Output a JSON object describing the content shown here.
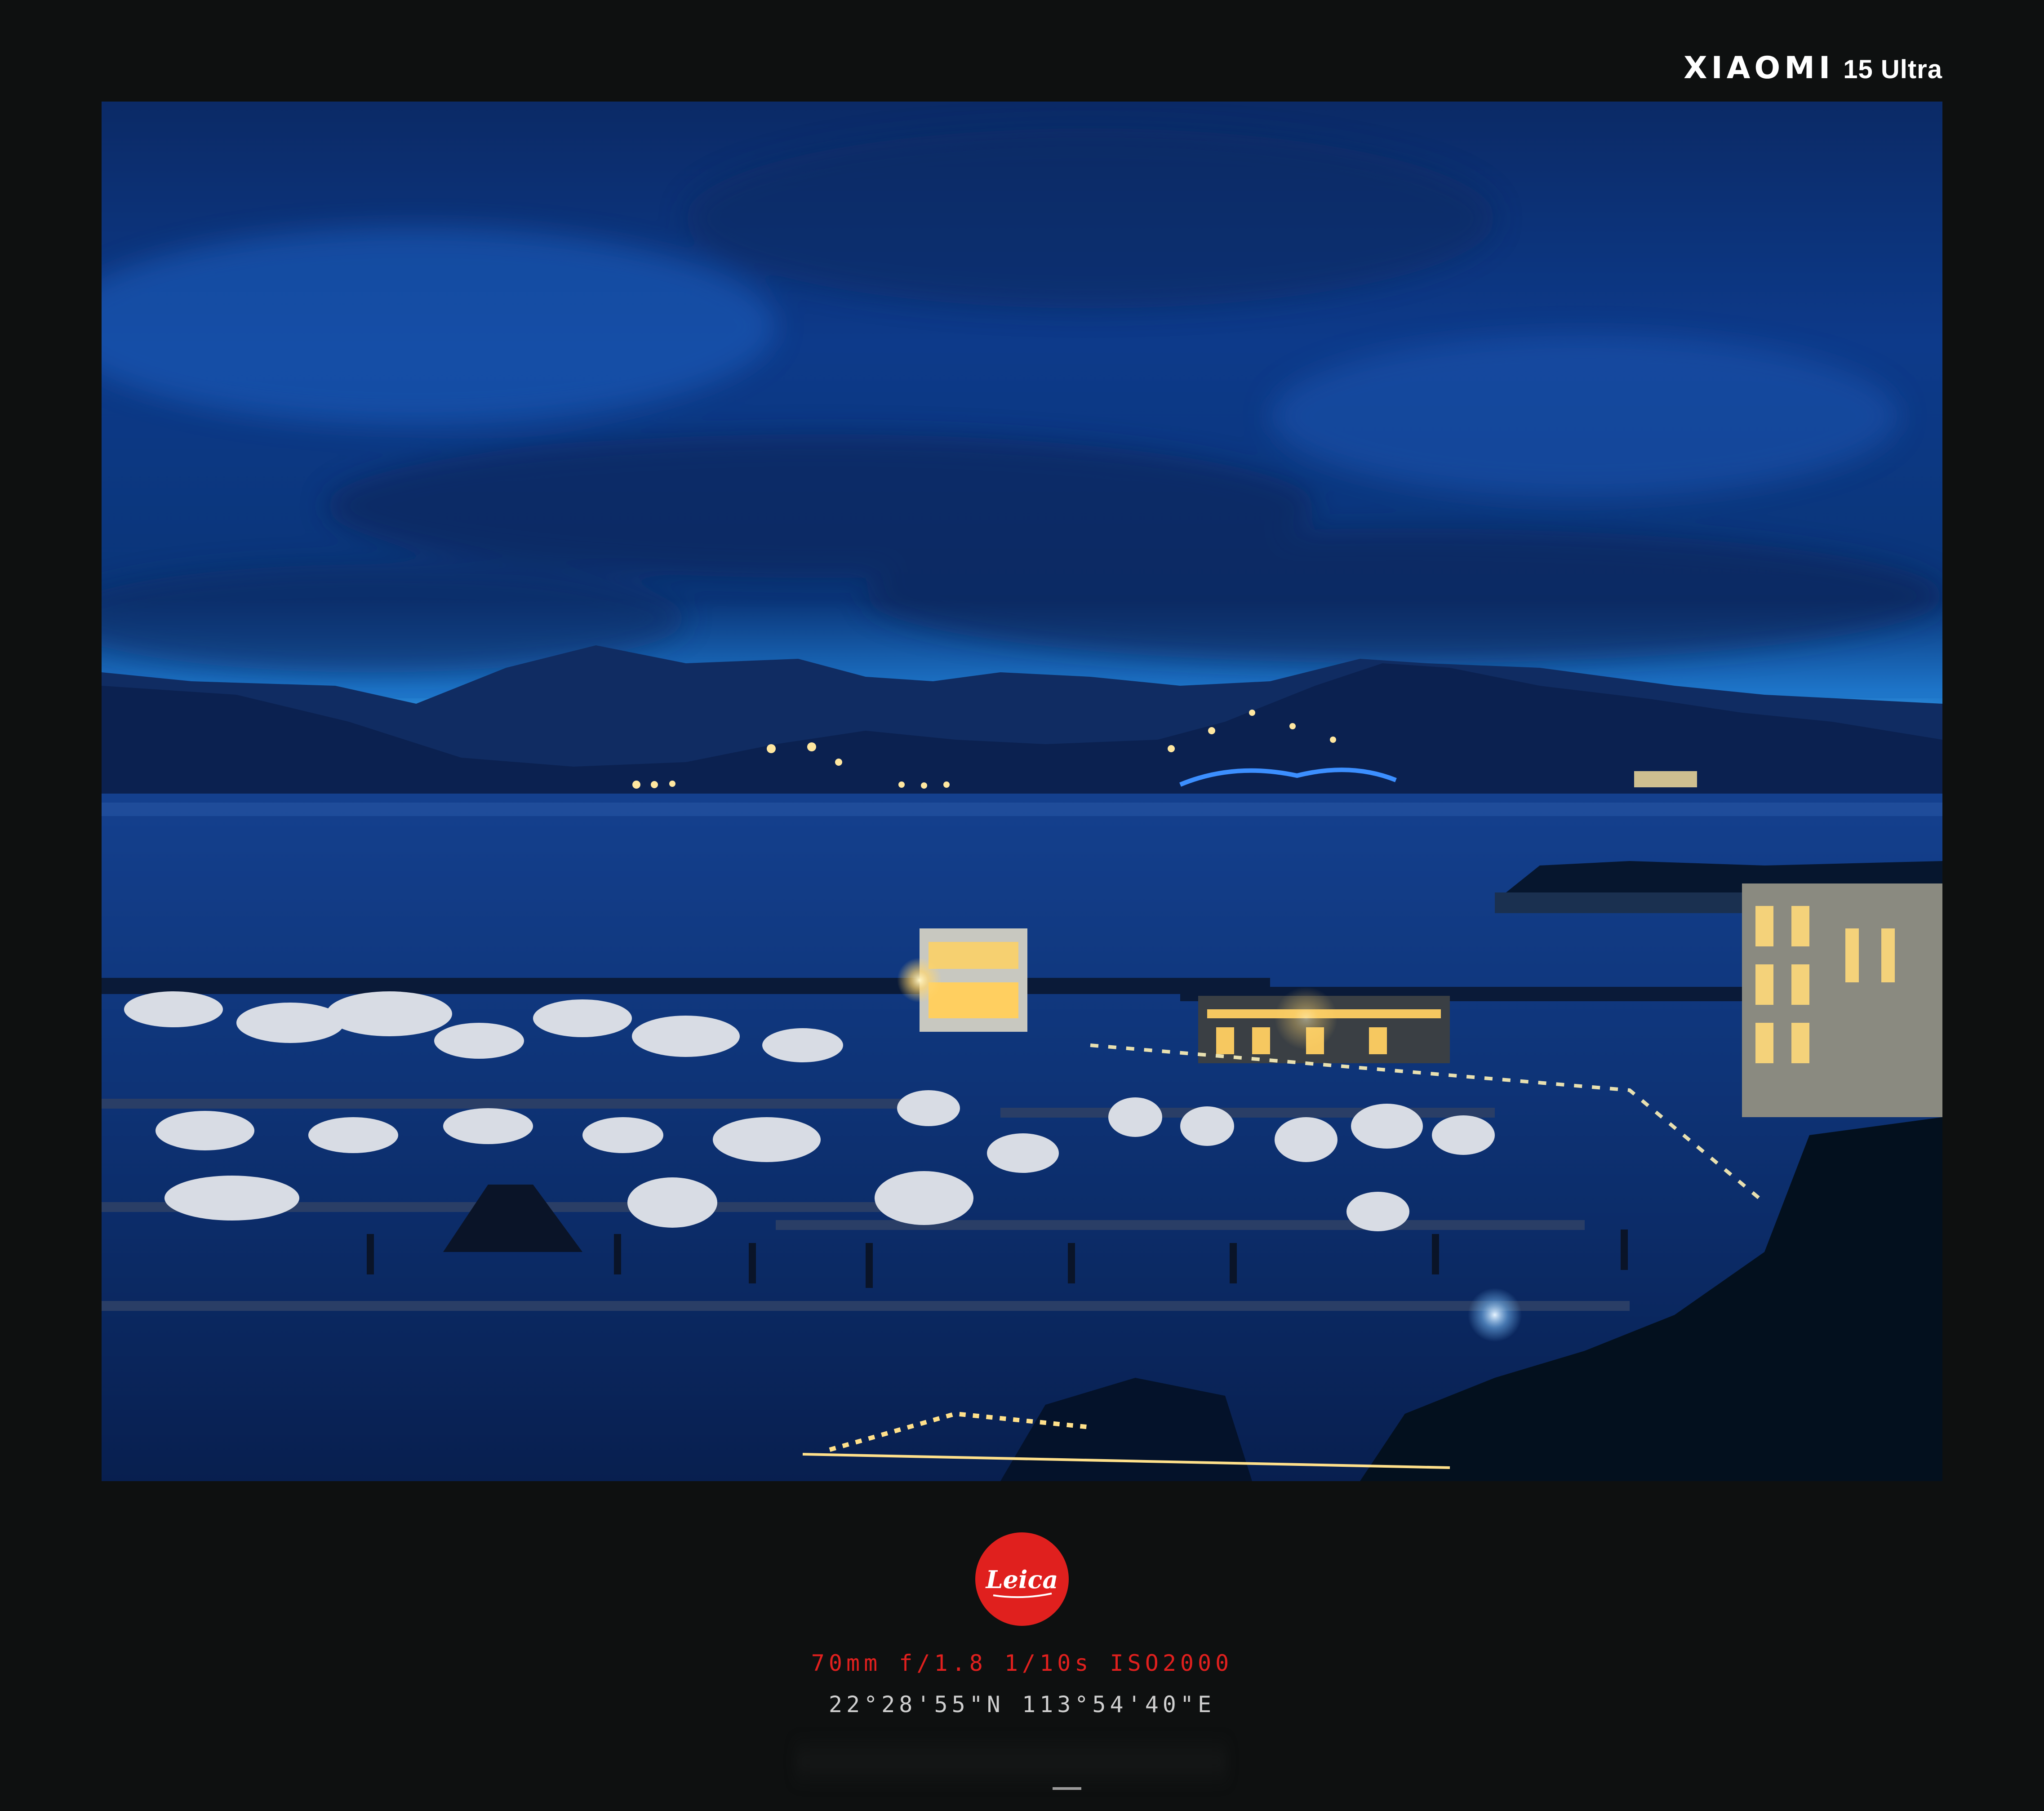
{
  "brand": {
    "name": "XIAOMI",
    "model": "15 Ultra"
  },
  "photo": {
    "scene": "night harbor marina with yachts, bay, mountains, blue cloudy sky"
  },
  "logo": {
    "text": "Leica",
    "color": "#e0201e"
  },
  "exif": {
    "settings": "70mm  f/1.8  1/10s  ISO2000",
    "coordinates": "22°28'55\"N  113°54'40\"E"
  },
  "colors": {
    "background": "#0e1010",
    "accent_red": "#e0201e"
  }
}
